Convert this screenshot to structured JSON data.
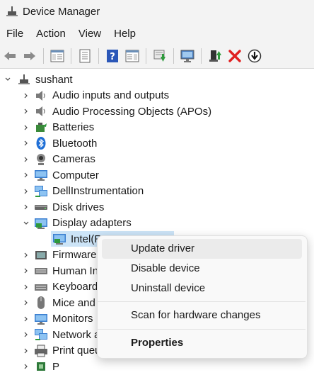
{
  "window": {
    "title": "Device Manager",
    "icon": "device-manager-icon"
  },
  "menu": {
    "file": "File",
    "action": "Action",
    "view": "View",
    "help": "Help"
  },
  "toolbar": {
    "buttons": [
      "back-icon",
      "forward-icon",
      "show-hide-console-tree-icon",
      "properties-icon",
      "help-icon",
      "action-pane-icon",
      "update-driver-icon",
      "scan-hardware-icon",
      "enable-device-icon",
      "uninstall-icon",
      "disable-device-icon"
    ]
  },
  "tree": {
    "root": "sushant",
    "items": [
      {
        "label": "Audio inputs and outputs",
        "icon": "speaker-icon"
      },
      {
        "label": "Audio Processing Objects (APOs)",
        "icon": "speaker-icon"
      },
      {
        "label": "Batteries",
        "icon": "battery-icon"
      },
      {
        "label": "Bluetooth",
        "icon": "bluetooth-icon"
      },
      {
        "label": "Cameras",
        "icon": "camera-icon"
      },
      {
        "label": "Computer",
        "icon": "monitor-icon"
      },
      {
        "label": "DellInstrumentation",
        "icon": "network-icon"
      },
      {
        "label": "Disk drives",
        "icon": "disk-icon"
      },
      {
        "label": "Display adapters",
        "icon": "display-adapter-icon"
      },
      {
        "label": "Intel(R",
        "icon": "display-adapter-icon"
      },
      {
        "label": "Firmware",
        "icon": "firmware-icon"
      },
      {
        "label": "Human In",
        "icon": "keyboard-icon"
      },
      {
        "label": "Keyboard",
        "icon": "keyboard-icon"
      },
      {
        "label": "Mice and",
        "icon": "mouse-icon"
      },
      {
        "label": "Monitors",
        "icon": "monitor-icon"
      },
      {
        "label": "Network a",
        "icon": "network-icon"
      },
      {
        "label": "Print queues",
        "icon": "printer-icon"
      },
      {
        "label": "P",
        "icon": "processor-icon"
      }
    ]
  },
  "context_menu": {
    "update_driver": "Update driver",
    "disable_device": "Disable device",
    "uninstall_device": "Uninstall device",
    "scan": "Scan for hardware changes",
    "properties": "Properties"
  }
}
